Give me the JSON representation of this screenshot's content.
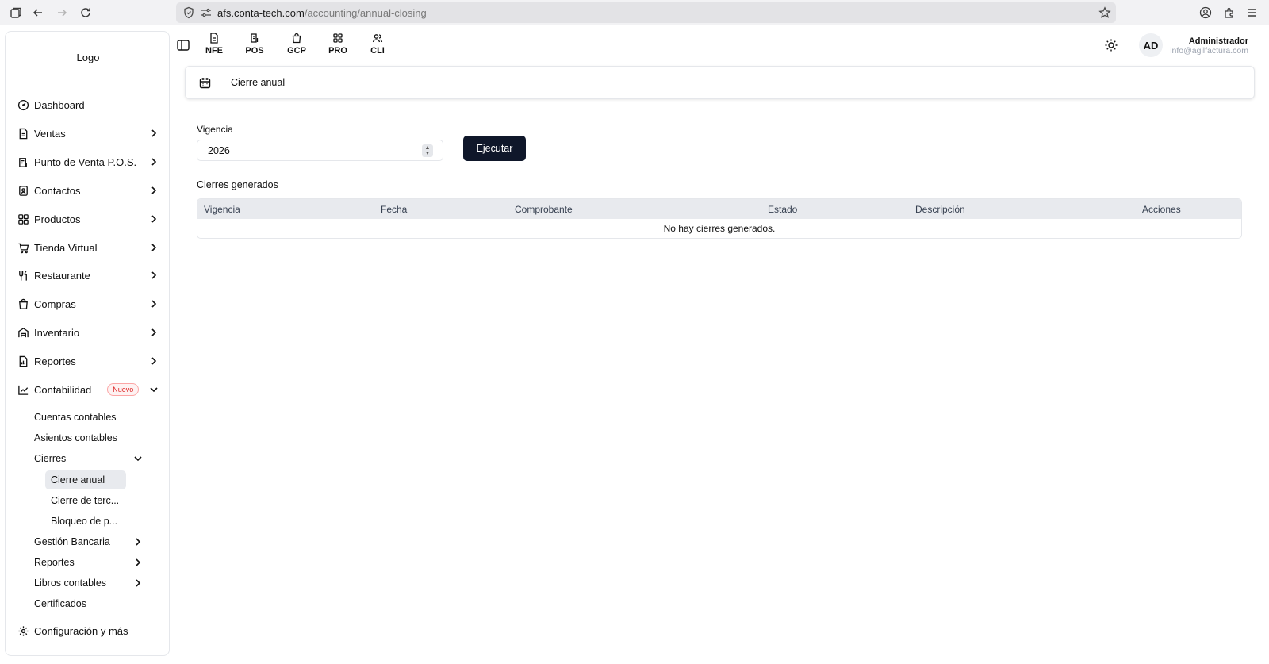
{
  "browser": {
    "url_host": "afs.conta-tech.com",
    "url_path": "/accounting/annual-closing"
  },
  "sidebar": {
    "logo": "Logo",
    "items": [
      {
        "label": "Dashboard",
        "icon": "gauge-icon"
      },
      {
        "label": "Ventas",
        "icon": "document-icon"
      },
      {
        "label": "Punto de Venta P.O.S.",
        "icon": "pos-icon"
      },
      {
        "label": "Contactos",
        "icon": "contacts-icon"
      },
      {
        "label": "Productos",
        "icon": "grid-icon"
      },
      {
        "label": "Tienda Virtual",
        "icon": "cart-icon"
      },
      {
        "label": "Restaurante",
        "icon": "utensils-icon"
      },
      {
        "label": "Compras",
        "icon": "shopping-bag-icon"
      },
      {
        "label": "Inventario",
        "icon": "warehouse-icon"
      },
      {
        "label": "Reportes",
        "icon": "report-icon"
      },
      {
        "label": "Contabilidad",
        "icon": "chart-icon",
        "badge": "Nuevo"
      }
    ],
    "accounting_sub": [
      "Cuentas contables",
      "Asientos contables",
      "Cierres",
      "Gestión Bancaria",
      "Reportes",
      "Libros contables",
      "Certificados"
    ],
    "closings_sub": [
      "Cierre anual",
      "Cierre de terc...",
      "Bloqueo de p..."
    ],
    "settings": "Configuración y más"
  },
  "topbar": {
    "apps": [
      "NFE",
      "POS",
      "GCP",
      "PRO",
      "CLI"
    ],
    "avatar": "AD",
    "user_name": "Administrador",
    "user_email": "info@agilfactura.com"
  },
  "page": {
    "title": "Cierre anual",
    "vigencia_label": "Vigencia",
    "vigencia_value": "2026",
    "execute_label": "Ejecutar",
    "section_title": "Cierres generados",
    "columns": [
      "Vigencia",
      "Fecha",
      "Comprobante",
      "Estado",
      "Descripción",
      "Acciones"
    ],
    "empty_message": "No hay cierres generados."
  }
}
